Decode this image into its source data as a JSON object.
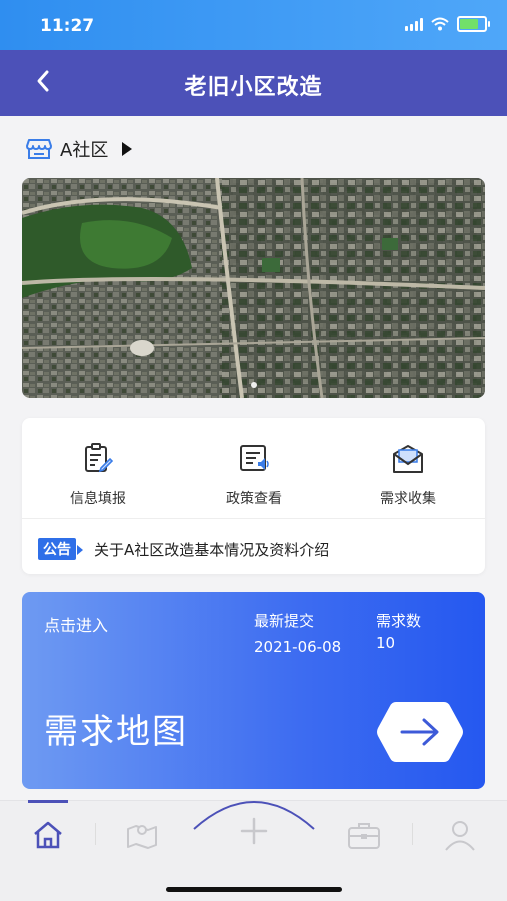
{
  "status": {
    "time": "11:27"
  },
  "navbar": {
    "title": "老旧小区改造"
  },
  "community": {
    "name": "A社区"
  },
  "services": [
    {
      "label": "信息填报",
      "icon": "form-edit-icon"
    },
    {
      "label": "政策查看",
      "icon": "policy-doc-icon"
    },
    {
      "label": "需求收集",
      "icon": "envelope-icon"
    }
  ],
  "notice": {
    "badge": "公告",
    "text": "关于A社区改造基本情况及资料介绍"
  },
  "demand_map": {
    "enter_label": "点击进入",
    "latest_label": "最新提交",
    "latest_value": "2021-06-08",
    "count_label": "需求数",
    "count_value": "10",
    "title": "需求地图"
  },
  "tabbar": {
    "tabs": [
      "home-icon",
      "map-icon",
      "plus-icon",
      "briefcase-icon",
      "user-icon"
    ]
  },
  "colors": {
    "nav": "#4c51b8",
    "status": "#2f8ef0",
    "card_gradient_end": "#2558f0",
    "badge": "#2f6fe8"
  }
}
